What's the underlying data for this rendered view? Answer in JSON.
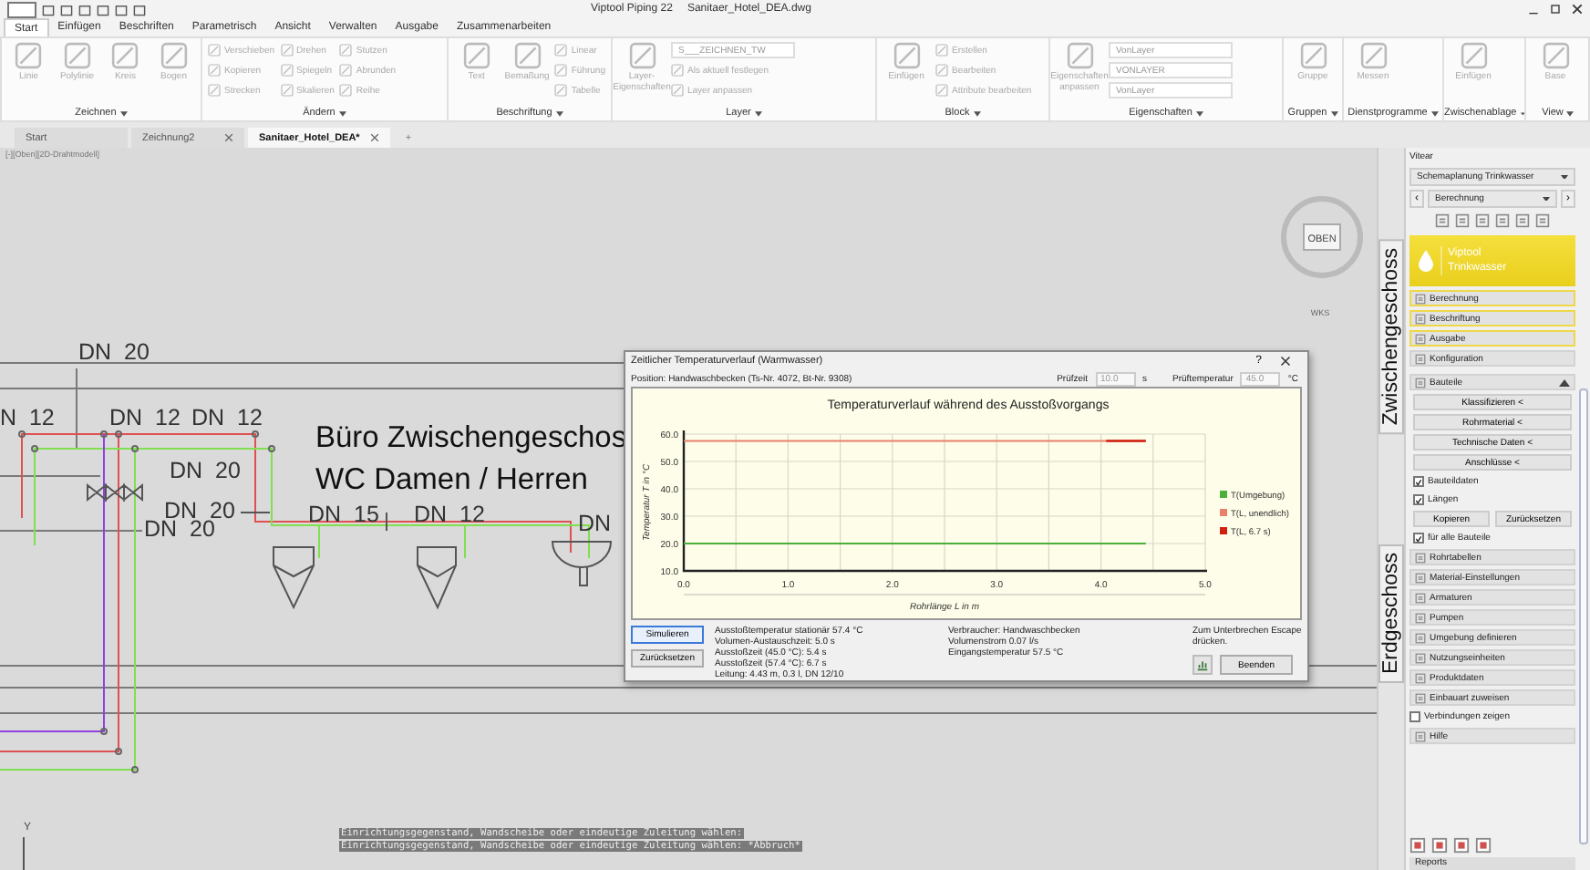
{
  "window": {
    "app_title": "Viptool Piping 22",
    "file_title": "Sanitaer_Hotel_DEA.dwg"
  },
  "ribbon_tabs": [
    {
      "label": "Start",
      "selected": true
    },
    {
      "label": "Einfügen",
      "selected": false
    },
    {
      "label": "Beschriften",
      "selected": false
    },
    {
      "label": "Parametrisch",
      "selected": false
    },
    {
      "label": "Ansicht",
      "selected": false
    },
    {
      "label": "Verwalten",
      "selected": false
    },
    {
      "label": "Ausgabe",
      "selected": false
    },
    {
      "label": "Zusammenarbeiten",
      "selected": false
    }
  ],
  "ribbon_groups": [
    {
      "label": "Zeichnen",
      "items": [
        {
          "kind": "large",
          "label": "Linie"
        },
        {
          "kind": "large",
          "label": "Polylinie"
        },
        {
          "kind": "large",
          "label": "Kreis"
        },
        {
          "kind": "large",
          "label": "Bogen"
        }
      ]
    },
    {
      "label": "Ändern",
      "items": [
        {
          "kind": "small",
          "label": "Verschieben"
        },
        {
          "kind": "small",
          "label": "Kopieren"
        },
        {
          "kind": "small",
          "label": "Strecken"
        },
        {
          "kind": "small",
          "label": "Drehen"
        },
        {
          "kind": "small",
          "label": "Spiegeln"
        },
        {
          "kind": "small",
          "label": "Skalieren"
        },
        {
          "kind": "small",
          "label": "Stutzen"
        },
        {
          "kind": "small",
          "label": "Abrunden"
        },
        {
          "kind": "small",
          "label": "Reihe"
        }
      ]
    },
    {
      "label": "Beschriftung",
      "items": [
        {
          "kind": "large",
          "label": "Text"
        },
        {
          "kind": "large",
          "label": "Bemaßung"
        },
        {
          "kind": "small",
          "label": "Linear"
        },
        {
          "kind": "small",
          "label": "Führung"
        },
        {
          "kind": "small",
          "label": "Tabelle"
        }
      ]
    },
    {
      "label": "Layer",
      "items": [
        {
          "kind": "large",
          "label": "Layer-Eigenschaften"
        },
        {
          "kind": "field",
          "label": "S___ZEICHNEN_TW"
        },
        {
          "kind": "small",
          "label": "Als aktuell festlegen"
        },
        {
          "kind": "small",
          "label": "Layer anpassen"
        }
      ]
    },
    {
      "label": "Block",
      "items": [
        {
          "kind": "large",
          "label": "Einfügen"
        },
        {
          "kind": "small",
          "label": "Erstellen"
        },
        {
          "kind": "small",
          "label": "Bearbeiten"
        },
        {
          "kind": "small",
          "label": "Attribute bearbeiten"
        }
      ]
    },
    {
      "label": "Eigenschaften",
      "items": [
        {
          "kind": "large",
          "label": "Eigenschaften anpassen"
        },
        {
          "kind": "field",
          "label": "VonLayer"
        },
        {
          "kind": "field",
          "label": "VONLAYER"
        },
        {
          "kind": "field",
          "label": "VonLayer"
        }
      ]
    },
    {
      "label": "Gruppen",
      "items": [
        {
          "kind": "large",
          "label": "Gruppe"
        }
      ]
    },
    {
      "label": "Dienstprogramme",
      "items": [
        {
          "kind": "large",
          "label": "Messen"
        }
      ]
    },
    {
      "label": "Zwischenablage",
      "items": [
        {
          "kind": "large",
          "label": "Einfügen"
        }
      ]
    },
    {
      "label": "View",
      "items": [
        {
          "kind": "large",
          "label": "Base"
        }
      ]
    }
  ],
  "doc_tabs": [
    {
      "label": "Start",
      "closable": false,
      "selected": false
    },
    {
      "label": "Zeichnung2",
      "closable": true,
      "selected": false
    },
    {
      "label": "Sanitaer_Hotel_DEA*",
      "closable": true,
      "selected": true
    }
  ],
  "new_tab": "+",
  "canvas": {
    "viewport_label": "[-][Oben][2D-Drahtmodell]",
    "viewcube_face": "OBEN",
    "viewcube_ucs": "WKS",
    "pipe_labels": [
      "DN  20",
      "N  12",
      "DN  12",
      "DN  12",
      "DN  20",
      "DN  20",
      "DN  20",
      "DN  15",
      "DN  12",
      "DN"
    ],
    "room_title": [
      "Büro Zwischengeschos",
      "WC Damen / Herren"
    ],
    "axis_label": "Y",
    "command_history": [
      "Einrichtungsgegenstand, Wandscheibe oder eindeutige Zuleitung wählen:",
      "Einrichtungsgegenstand, Wandscheibe oder eindeutige Zuleitung wählen: *Abbruch*"
    ]
  },
  "dialog": {
    "title": "Zeitlicher Temperaturverlauf (Warmwasser)",
    "help": "?",
    "position": "Position: Handwaschbecken (Ts-Nr. 4072, Bt-Nr. 9308)",
    "test_time": {
      "label": "Prüfzeit",
      "value": "10.0",
      "unit": "s"
    },
    "test_temp": {
      "label": "Prüftemperatur",
      "value": "45.0",
      "unit": "°C"
    },
    "chart_data": {
      "type": "line",
      "title": "Temperaturverlauf während des Ausstoßvorgangs",
      "xlabel": "Rohrlänge L in m",
      "ylabel": "Temperatur T in °C",
      "x": [
        0,
        4.05,
        4.43
      ],
      "series": [
        {
          "name": "T(Umgebung)",
          "color": "#4caf3a",
          "values": [
            20,
            20,
            20
          ]
        },
        {
          "name": "T(L, unendlich)",
          "color": "#e8806a",
          "values": [
            57.5,
            57.5,
            57.5
          ]
        },
        {
          "name": "T(L, 6.7 s)",
          "color": "#d02010",
          "values": [
            null,
            57.5,
            57.5
          ]
        }
      ],
      "grid": true,
      "legend": "right",
      "xlim": [
        0,
        5
      ],
      "ylim": [
        10,
        60
      ],
      "xticks": [
        {
          "value": 0,
          "label": "0.0"
        },
        {
          "value": 1,
          "label": "1.0"
        },
        {
          "value": 2,
          "label": "2.0"
        },
        {
          "value": 3,
          "label": "3.0"
        },
        {
          "value": 4,
          "label": "4.0"
        },
        {
          "value": 5,
          "label": "5.0"
        }
      ],
      "yticks": [
        {
          "value": 10,
          "label": "10.0"
        },
        {
          "value": 20,
          "label": "20.0"
        },
        {
          "value": 30,
          "label": "30.0"
        },
        {
          "value": 40,
          "label": "40.0"
        },
        {
          "value": 50,
          "label": "50.0"
        },
        {
          "value": 60,
          "label": "60.0"
        }
      ]
    },
    "buttons": [
      {
        "label": "Simulieren",
        "selected": true
      },
      {
        "label": "Zurücksetzen",
        "selected": false
      }
    ],
    "results": [
      "Ausstoßtemperatur stationär 57.4 °C",
      "Volumen-Austauschzeit: 5.0 s",
      "Ausstoßzeit (45.0 °C): 5.4 s",
      "Ausstoßzeit (57.4 °C): 6.7 s",
      "Leitung: 4.43 m, 0.3 l, DN 12/10"
    ],
    "consumer": [
      "Verbraucher: Handwaschbecken",
      "Volumenstrom 0.07 l/s",
      "Eingangstemperatur 57.5 °C"
    ],
    "hint": "Zum Unterbrechen Escape drücken.",
    "close_button": "Beenden"
  },
  "level_tabs": [
    {
      "label": "Zwischengeschoss"
    },
    {
      "label": "Erdgeschoss"
    }
  ],
  "side_panel": {
    "header": "Vitear",
    "scheme": "Schemaplanung Trinkwasser",
    "mode": "Berechnung",
    "nav_prev": "‹",
    "nav_next": "›",
    "brand": [
      "Viptool",
      "Trinkwasser"
    ],
    "actions": [
      {
        "label": "Berechnung",
        "highlighted": true
      },
      {
        "label": "Beschriftung",
        "highlighted": true
      },
      {
        "label": "Ausgabe",
        "highlighted": true
      },
      {
        "label": "Konfiguration",
        "highlighted": false
      }
    ],
    "section": {
      "title": "Bauteile",
      "expanded": true,
      "buttons": [
        "Klassifizieren <",
        "Rohrmaterial <",
        "Technische Daten <",
        "Anschlüsse <"
      ],
      "options": [
        {
          "label": "Bauteildaten",
          "checked": true
        },
        {
          "label": "Längen",
          "checked": true
        }
      ],
      "pair": [
        "Kopieren",
        "Zurücksetzen"
      ],
      "all_parts": {
        "label": "für alle Bauteile",
        "checked": true
      }
    },
    "tools": [
      {
        "kind": "button",
        "label": "Rohrtabellen"
      },
      {
        "kind": "button",
        "label": "Material-Einstellungen"
      },
      {
        "kind": "button",
        "label": "Armaturen"
      },
      {
        "kind": "button",
        "label": "Pumpen"
      },
      {
        "kind": "button",
        "label": "Umgebung definieren"
      },
      {
        "kind": "button",
        "label": "Nutzungseinheiten"
      },
      {
        "kind": "button",
        "label": "Produktdaten"
      },
      {
        "kind": "button",
        "label": "Einbauart zuweisen"
      },
      {
        "kind": "checkbox",
        "label": "Verbindungen zeigen",
        "checked": false
      },
      {
        "kind": "button",
        "label": "Hilfe"
      }
    ],
    "footer": "Reports"
  }
}
